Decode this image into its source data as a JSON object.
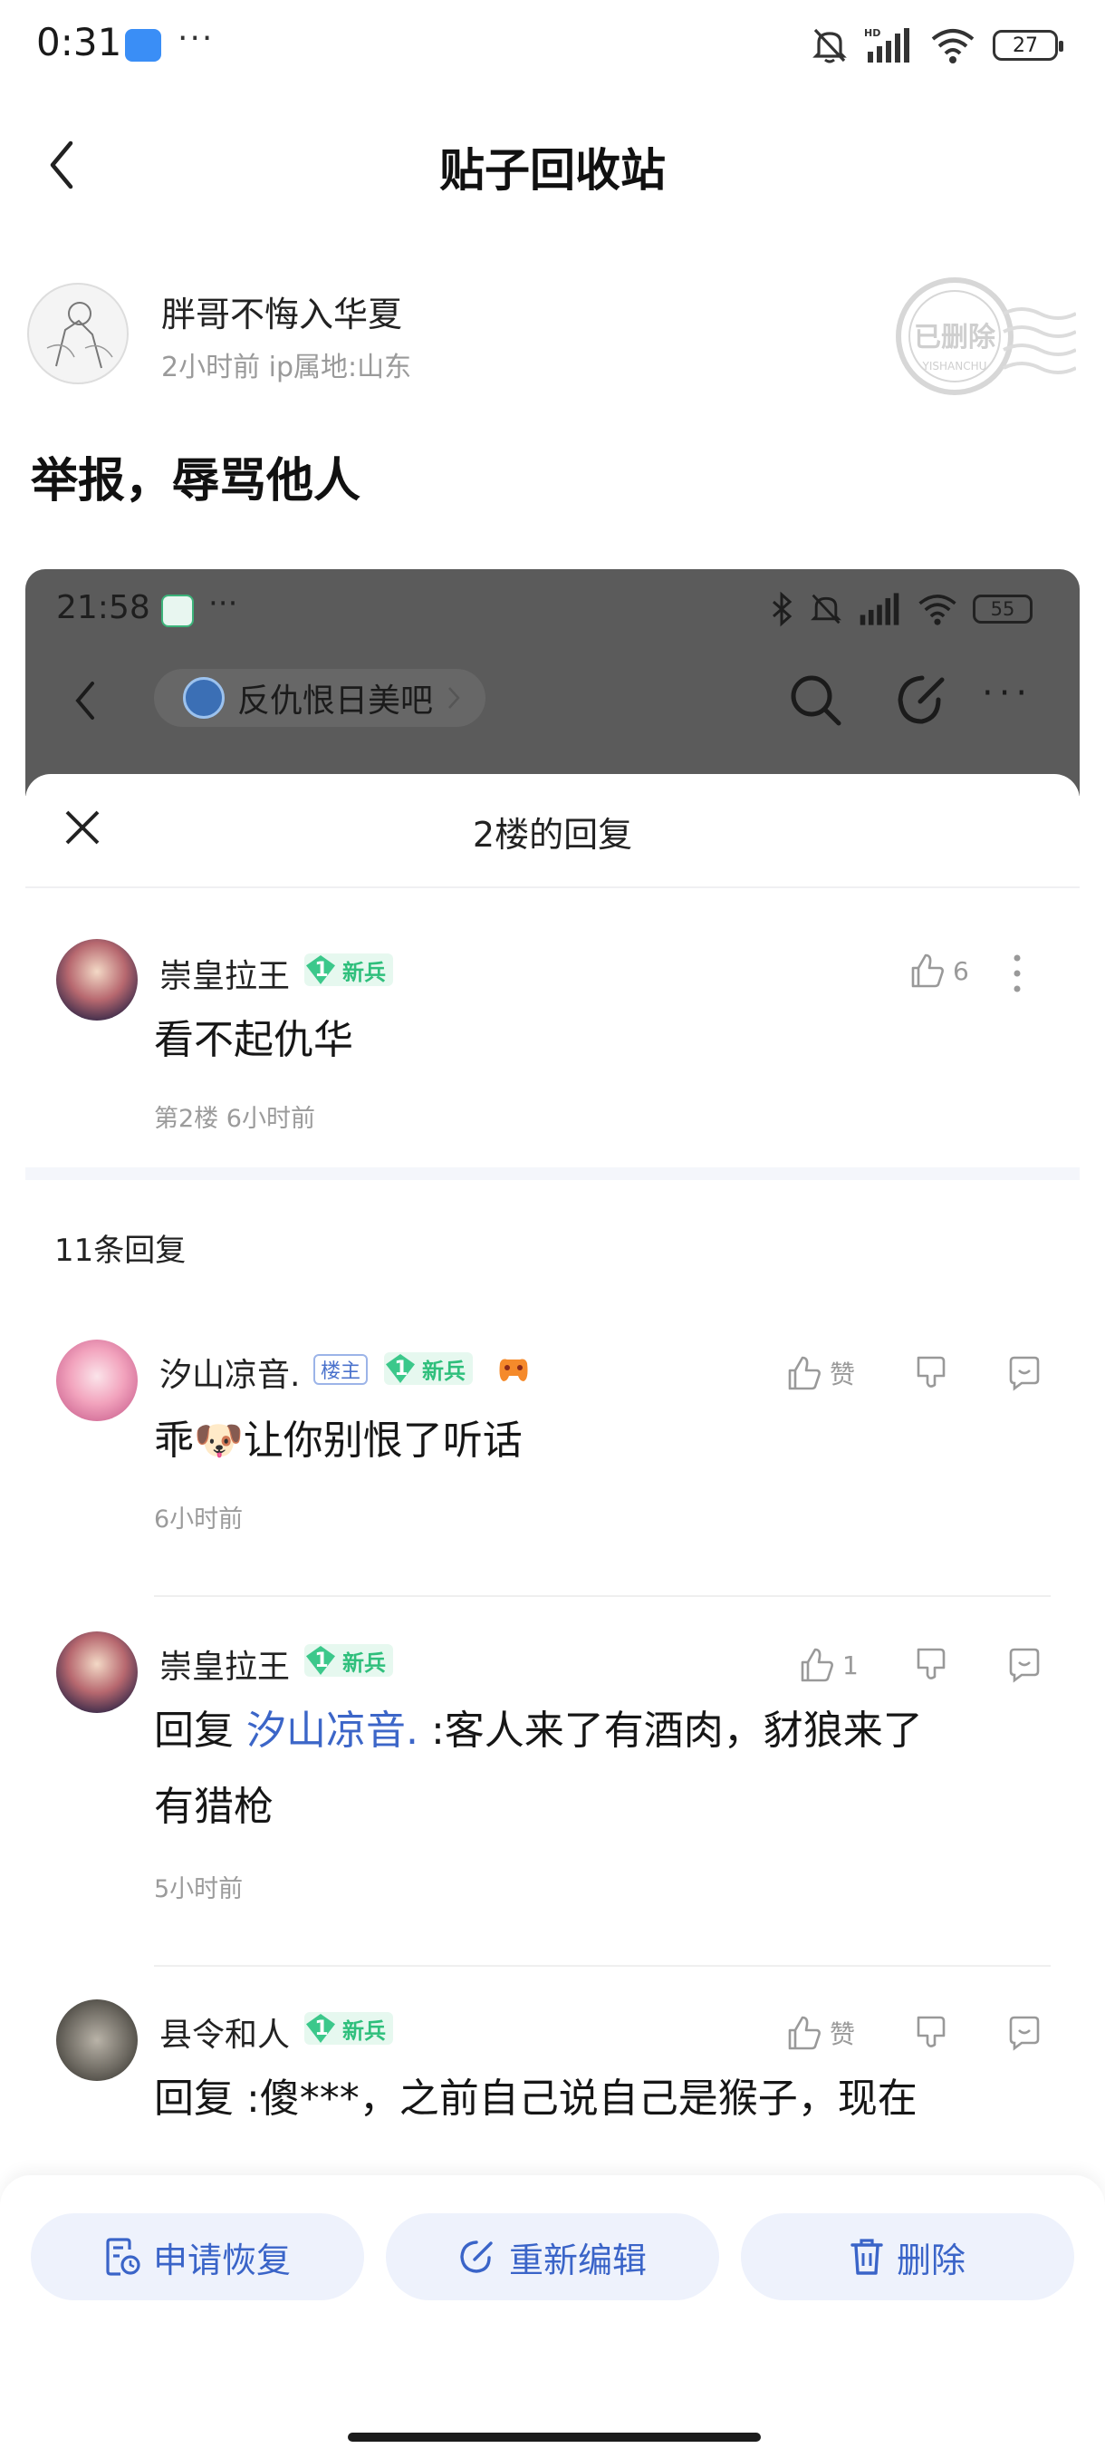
{
  "status_bar": {
    "time": "0:31",
    "dots": "···",
    "battery": "27"
  },
  "header": {
    "title": "贴子回收站"
  },
  "post": {
    "author": "胖哥不悔入华夏",
    "meta": "2小时前   ip属地:山东",
    "stamp_text": "已删除",
    "stamp_sub": "YISHANCHU",
    "title": "举报，辱骂他人"
  },
  "screenshot": {
    "status_time": "21:58",
    "status_dots": "···",
    "battery": "55",
    "forum_name": "反仇恨日美吧",
    "more": "···",
    "sheet_title": "2楼的回复",
    "floor_post": {
      "user": "崇皇拉王",
      "level": "1",
      "level_label": "新兵",
      "likes": "6",
      "content": "看不起仇华",
      "meta": "第2楼   6小时前"
    },
    "reply_count": "11条回复",
    "replies": [
      {
        "user": "汐山凉音.",
        "host_tag": "楼主",
        "level": "1",
        "level_label": "新兵",
        "like": "赞",
        "content_a": "乖",
        "emoji": "🐶",
        "content_b": "让你别恨了听话",
        "time": "6小时前"
      },
      {
        "user": "崇皇拉王",
        "level": "1",
        "level_label": "新兵",
        "like": "1",
        "reply_prefix": "回复 ",
        "mention": "汐山凉音.",
        "content_line1": " :客人来了有酒肉，豺狼来了",
        "content_line2": "有猎枪",
        "time": "5小时前"
      },
      {
        "user": "县令和人",
        "level": "1",
        "level_label": "新兵",
        "like": "赞",
        "content": "回复   :傻***，之前自己说自己是猴子，现在"
      }
    ]
  },
  "bottom_bar": {
    "restore": "申请恢复",
    "reedit": "重新编辑",
    "delete": "删除"
  },
  "colors": {
    "accent": "#3a64c8",
    "button_bg": "#eef2fc",
    "level_green": "#3cc88b",
    "mention": "#3c66c8"
  }
}
